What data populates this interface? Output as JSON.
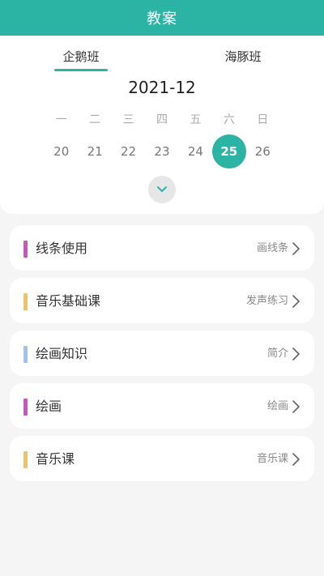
{
  "header": {
    "title": "教案"
  },
  "tabs": [
    {
      "label": "企鹅班",
      "active": true
    },
    {
      "label": "海豚班",
      "active": false
    }
  ],
  "calendar": {
    "month": "2021-12",
    "weekdays": [
      "一",
      "二",
      "三",
      "四",
      "五",
      "六",
      "日"
    ],
    "dates": [
      "20",
      "21",
      "22",
      "23",
      "24",
      "25",
      "26"
    ],
    "selected_date": "25",
    "expand_icon": "chevron-down-icon"
  },
  "lessons": [
    {
      "title": "线条使用",
      "subtitle": "画线条",
      "color": "#d54fbf"
    },
    {
      "title": "音乐基础课",
      "subtitle": "发声练习",
      "color": "#f0c35b"
    },
    {
      "title": "绘画知识",
      "subtitle": "简介",
      "color": "#9cc3ee"
    },
    {
      "title": "绘画",
      "subtitle": "绘画",
      "color": "#d54fbf"
    },
    {
      "title": "音乐课",
      "subtitle": "音乐课",
      "color": "#f0c35b"
    }
  ],
  "colors": {
    "accent": "#2bb3a3"
  }
}
